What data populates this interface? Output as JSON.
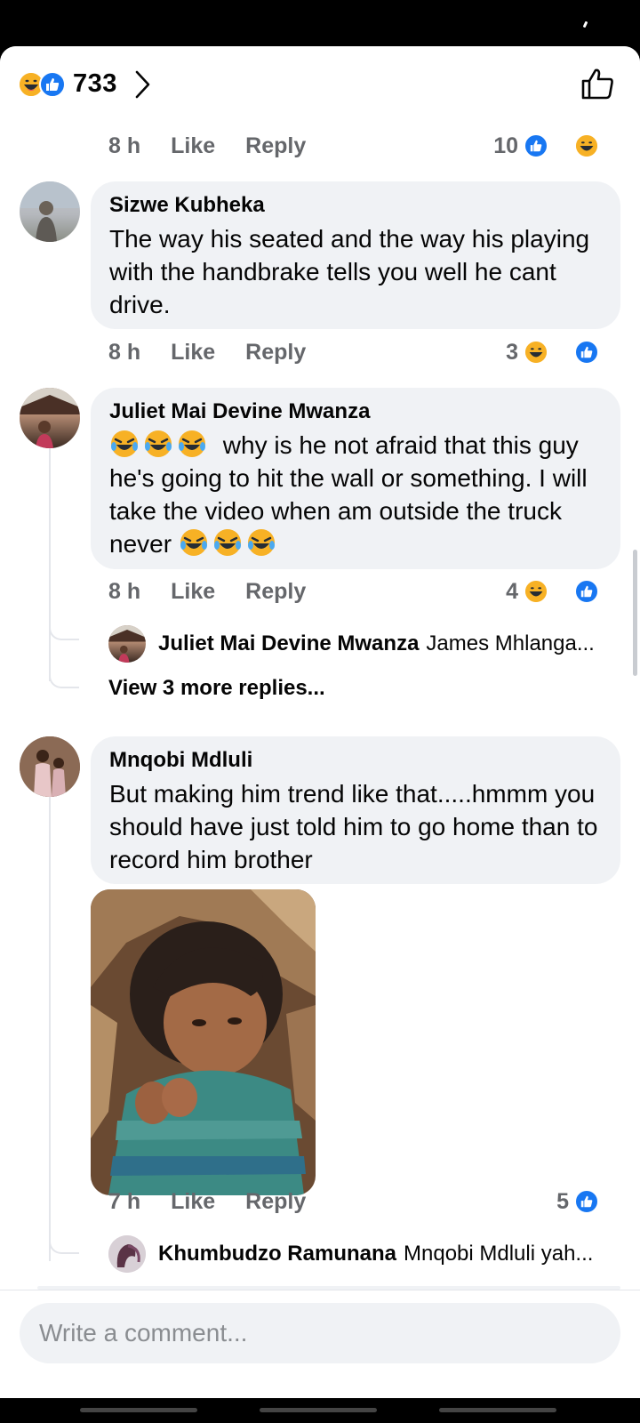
{
  "header": {
    "reaction_count": "733",
    "reactions": [
      "haha",
      "like"
    ]
  },
  "top_comment": {
    "time": "8 h",
    "like_label": "Like",
    "reply_label": "Reply",
    "reaction_count": "10"
  },
  "comments": [
    {
      "author": "Sizwe Kubheka",
      "text": "The way his seated and the way his playing with the handbrake tells you well he cant drive.",
      "time": "8 h",
      "like_label": "Like",
      "reply_label": "Reply",
      "reaction_count": "3"
    },
    {
      "author": "Juliet Mai Devine Mwanza",
      "text": "why is he not afraid that this guy he's going to hit the wall or something. I will take the video  when am outside the truck never",
      "time": "8 h",
      "like_label": "Like",
      "reply_label": "Reply",
      "reaction_count": "4",
      "reply_preview": {
        "author": "Juliet Mai Devine Mwanza",
        "text": "James Mhlanga..."
      },
      "view_more": "View 3 more replies..."
    },
    {
      "author": "Mnqobi Mdluli",
      "text": "But making him trend like that.....hmmm you should have just told him to go home than to record him brother",
      "time": "7 h",
      "like_label": "Like",
      "reply_label": "Reply",
      "reaction_count": "5",
      "reply_preview": {
        "author": "Khumbudzo Ramunana",
        "text": "Mnqobi Mdluli yah..."
      }
    }
  ],
  "composer": {
    "placeholder": "Write a comment..."
  },
  "colors": {
    "like_blue": "#1877f2",
    "haha_yellow": "#f7b125",
    "bubble_bg": "#f0f2f5",
    "meta_gray": "#65676b"
  }
}
